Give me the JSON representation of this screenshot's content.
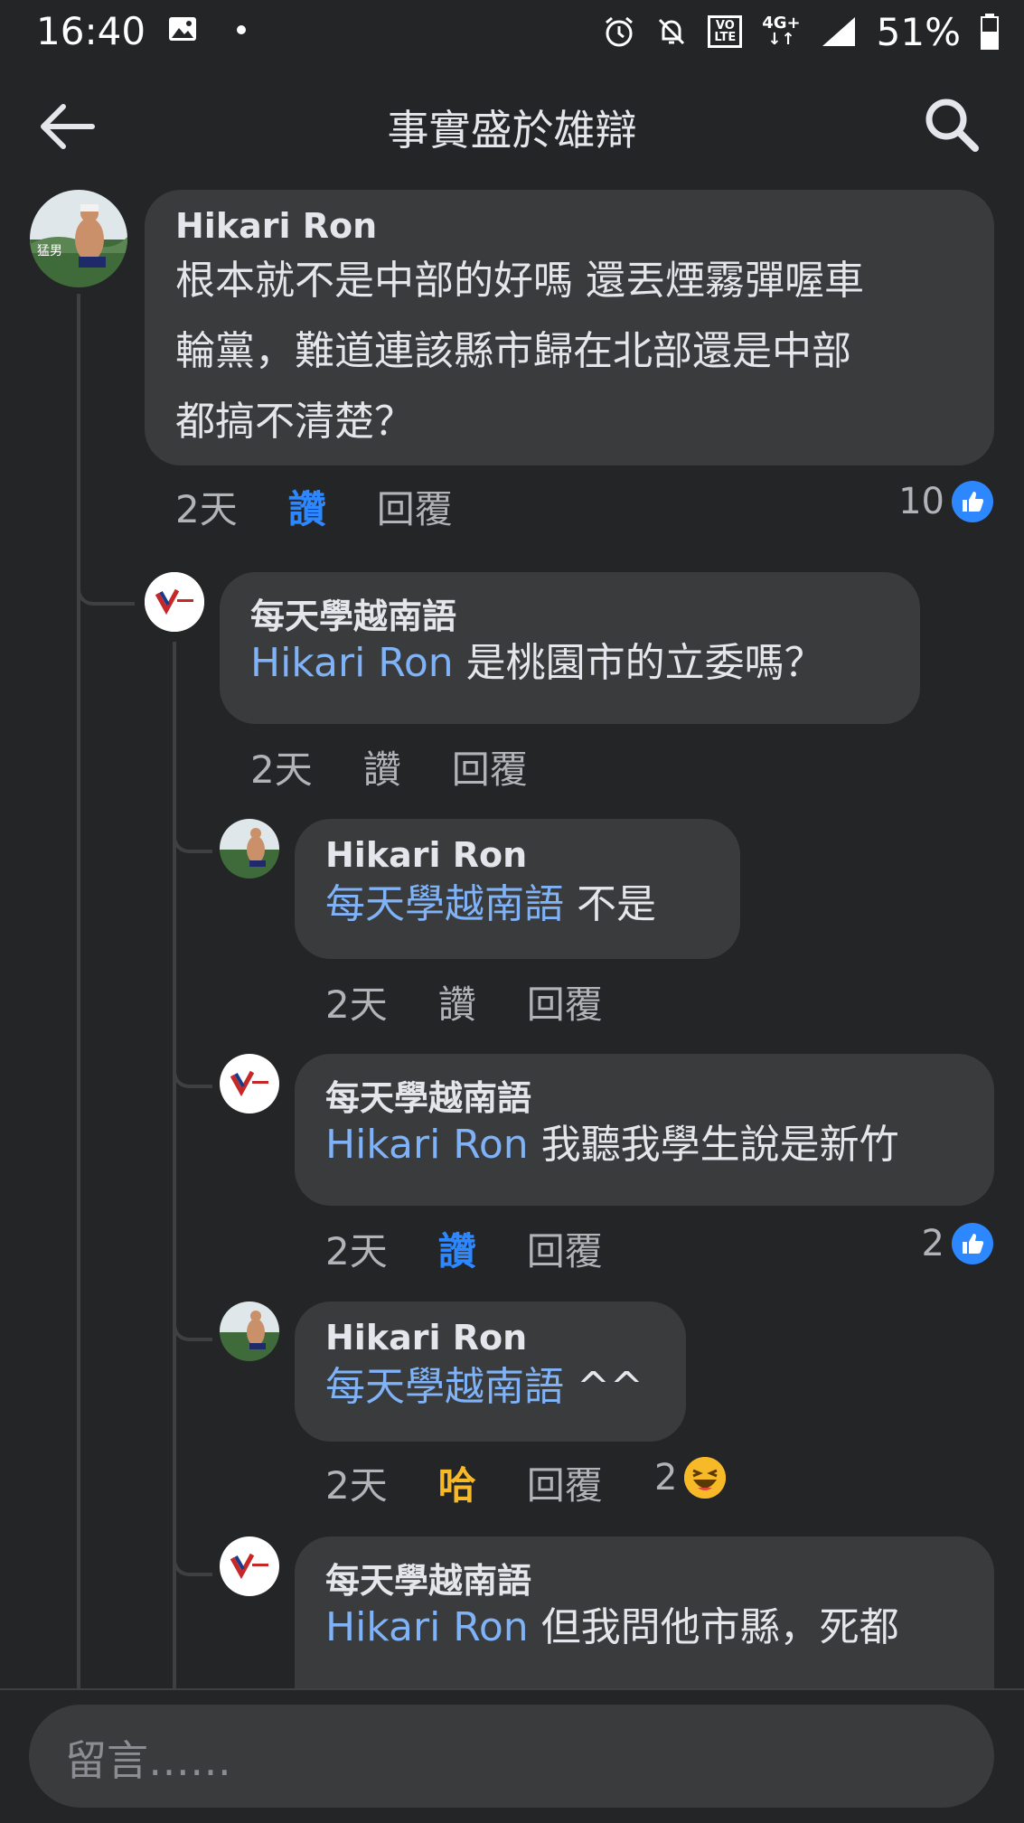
{
  "status": {
    "time": "16:40",
    "network": "4G+",
    "volte": "VO\nLTE",
    "battery": "51%"
  },
  "header": {
    "title": "事實盛於雄辯"
  },
  "comments": [
    {
      "author": "Hikari Ron",
      "lines": [
        "根本就不是中部的好嗎 還丟煙霧彈喔車",
        "輪黨，難道連該縣市歸在北部還是中部",
        "都搞不清楚？"
      ],
      "time": "2天",
      "like": "讚",
      "reply": "回覆",
      "reactions": "10"
    },
    {
      "author": "每天學越南語",
      "mention": "Hikari Ron",
      "text": " 是桃園市的立委嗎？",
      "time": "2天",
      "like": "讚",
      "reply": "回覆"
    },
    {
      "author": "Hikari Ron",
      "mention": "每天學越南語",
      "text": " 不是",
      "time": "2天",
      "like": "讚",
      "reply": "回覆"
    },
    {
      "author": "每天學越南語",
      "mention": "Hikari Ron",
      "text": " 我聽我學生說是新竹",
      "time": "2天",
      "like": "讚",
      "reply": "回覆",
      "reactions": "2"
    },
    {
      "author": "Hikari Ron",
      "mention": "每天學越南語",
      "text": " ^^",
      "time": "2天",
      "like": "哈",
      "reply": "回覆",
      "reactions": "2"
    },
    {
      "author": "每天學越南語",
      "mention": "Hikari Ron",
      "text": " 但我問他市縣，死都"
    }
  ],
  "composer": {
    "placeholder": "留言……"
  },
  "colors": {
    "background": "#242526",
    "bubble": "#3a3b3c",
    "mention": "#7fb2f6",
    "like_blue": "#2d88ff",
    "haha_yellow": "#f7b928"
  }
}
